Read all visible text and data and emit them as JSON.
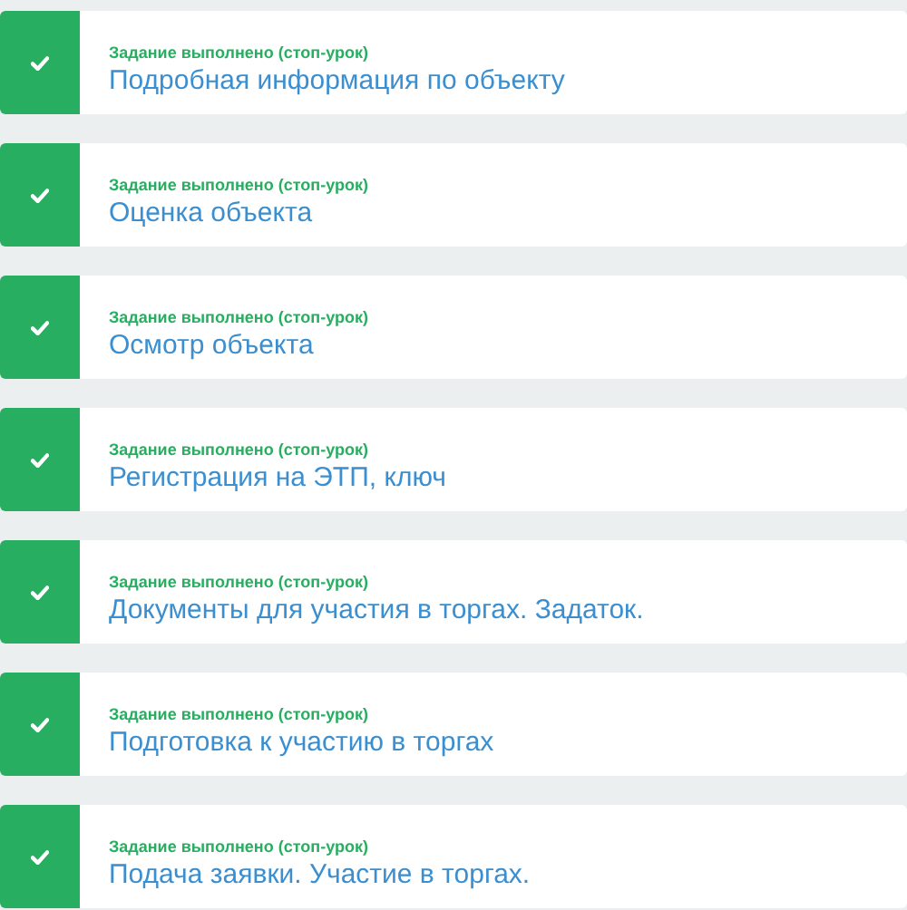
{
  "tasks": [
    {
      "status": "Задание выполнено (стоп-урок)",
      "title": "Подробная информация по объекту",
      "completed": true
    },
    {
      "status": "Задание выполнено (стоп-урок)",
      "title": "Оценка объекта",
      "completed": true
    },
    {
      "status": "Задание выполнено (стоп-урок)",
      "title": "Осмотр объекта",
      "completed": true
    },
    {
      "status": "Задание выполнено (стоп-урок)",
      "title": "Регистрация на ЭТП, ключ",
      "completed": true
    },
    {
      "status": "Задание выполнено (стоп-урок)",
      "title": "Документы для участия в торгах. Задаток.",
      "completed": true
    },
    {
      "status": "Задание выполнено (стоп-урок)",
      "title": "Подготовка к участию в торгах",
      "completed": true
    },
    {
      "status": "Задание выполнено (стоп-урок)",
      "title": "Подача заявки. Участие в торгах.",
      "completed": true
    }
  ]
}
